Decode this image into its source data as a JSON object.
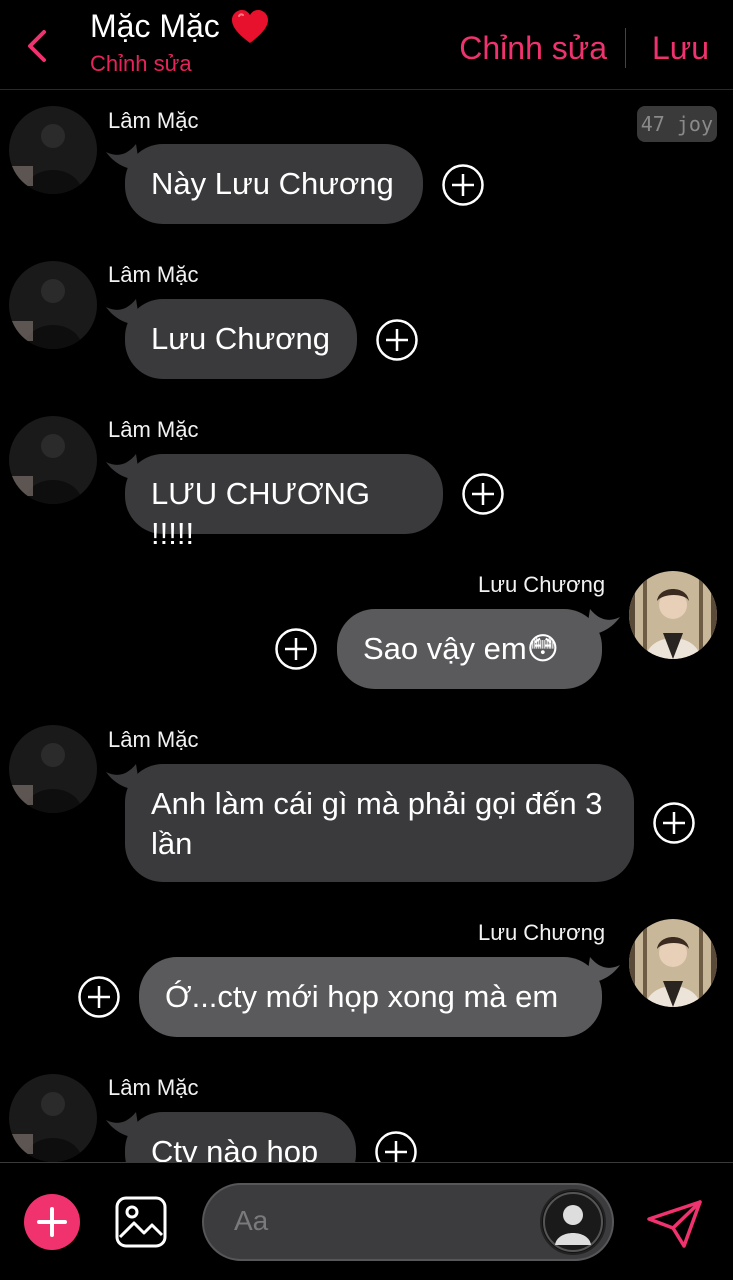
{
  "header": {
    "title": "Mặc Mặc",
    "subtitle": "Chỉnh sửa",
    "edit_label": "Chỉnh sửa",
    "save_label": "Lưu"
  },
  "badge": "47 joy",
  "messages": [
    {
      "sender": "Lâm Mặc",
      "side": "left",
      "text": "Này Lưu Chương"
    },
    {
      "sender": "Lâm Mặc",
      "side": "left",
      "text": "Lưu Chương"
    },
    {
      "sender": "Lâm Mặc",
      "side": "left",
      "text": "LƯU CHƯƠNG !!!!!"
    },
    {
      "sender": "Lưu Chương",
      "side": "right",
      "text": "Sao vậy em😳"
    },
    {
      "sender": "Lâm Mặc",
      "side": "left",
      "text": "Anh làm cái gì mà phải gọi đến 3 lần"
    },
    {
      "sender": "Lưu Chương",
      "side": "right",
      "text": "Ớ...cty mới họp xong mà em"
    },
    {
      "sender": "Lâm Mặc",
      "side": "left",
      "text": "Cty nào họp"
    }
  ],
  "composer": {
    "placeholder": "Aa"
  },
  "colors": {
    "accent": "#f0326e",
    "background": "#000000",
    "bubble_left": "#3a3a3c",
    "bubble_right": "#5a5a5c"
  },
  "icons": [
    "back-arrow-icon",
    "heart-icon",
    "add-reaction-icon",
    "plus-icon",
    "image-icon",
    "user-avatar-icon",
    "send-icon"
  ]
}
